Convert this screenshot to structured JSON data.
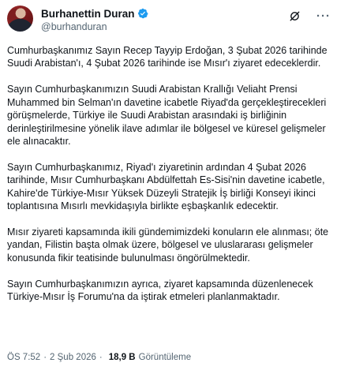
{
  "author": {
    "display_name": "Burhanettin Duran",
    "handle": "@burhanduran",
    "verified": true,
    "verified_color": "#1d9bf0"
  },
  "actions": {
    "grok_icon": "grok-icon",
    "more_icon": "more-icon",
    "more_glyph": "···"
  },
  "paragraphs": [
    "Cumhurbaşkanımız Sayın Recep Tayyip Erdoğan, 3 Şubat 2026 tarihinde Suudi Arabistan'ı, 4 Şubat 2026 tarihinde ise Mısır'ı ziyaret edeceklerdir.",
    "Sayın Cumhurbaşkanımızın Suudi Arabistan Krallığı Veliaht Prensi Muhammed bin Selman'ın davetine icabetle Riyad'da gerçekleştirecekleri görüşmelerde, Türkiye ile Suudi Arabistan arasındaki iş birliğinin derinleştirilmesine yönelik ilave adımlar ile bölgesel ve küresel gelişmeler ele alınacaktır.",
    "Sayın Cumhurbaşkanımız, Riyad'ı ziyaretinin ardından 4 Şubat 2026 tarihinde, Mısır Cumhurbaşkanı Abdülfettah Es-Sisi'nin davetine icabetle, Kahire'de Türkiye-Mısır Yüksek Düzeyli Stratejik İş birliği Konseyi ikinci toplantısına Mısırlı mevkidaşıyla birlikte eşbaşkanlık edecektir.",
    "Mısır ziyareti kapsamında ikili gündemimizdeki konuların ele alınması; öte yandan, Filistin başta olmak üzere, bölgesel ve uluslararası gelişmeler konusunda fikir teatisinde bulunulması öngörülmektedir.",
    "Sayın Cumhurbaşkanımızın ayrıca, ziyaret kapsamında düzenlenecek Türkiye-Mısır İş Forumu'na da iştirak etmeleri planlanmaktadır."
  ],
  "meta": {
    "time": "ÖS 7:52",
    "separator": "·",
    "date": "2 Şub 2026",
    "views_count": "18,9 B",
    "views_label": "Görüntüleme"
  }
}
